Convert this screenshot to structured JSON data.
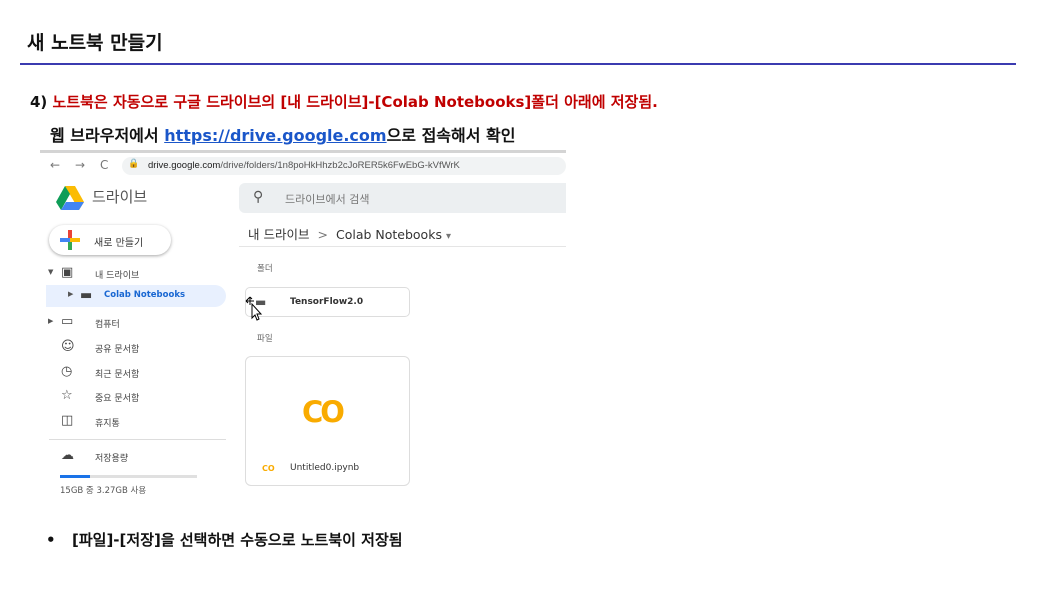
{
  "slide": {
    "title": "새 노트북 만들기",
    "step_num": "4)",
    "step_text": "노트북은 자동으로 구글 드라이브의 [내 드라이브]-[Colab Notebooks]폴더 아래에 저장됨.",
    "check_prefix": "웹 브라우저에서 ",
    "check_link": "https://drive.google.com",
    "check_suffix": "으로 접속해서 확인",
    "bullet_text": "[파일]-[저장]을 선택하면 수동으로 노트북이 저장됨"
  },
  "browser": {
    "back": "←",
    "forward": "→",
    "reload": "C",
    "lock": "🔒",
    "url_host": "drive.google.com",
    "url_path": "/drive/folders/1n8poHkHhzb2cJoRER5k6FwEbG-kVfWrK"
  },
  "drive": {
    "app_name": "드라이브",
    "search_placeholder": "드라이브에서 검색",
    "new_button": "새로 만들기",
    "sidebar": [
      {
        "label": "내 드라이브",
        "icon": "drive-icon"
      },
      {
        "label": "Colab Notebooks",
        "icon": "folder-icon"
      },
      {
        "label": "컴퓨터",
        "icon": "computer-icon"
      },
      {
        "label": "공유 문서함",
        "icon": "people-icon"
      },
      {
        "label": "최근 문서함",
        "icon": "clock-icon"
      },
      {
        "label": "중요 문서함",
        "icon": "star-icon"
      },
      {
        "label": "휴지통",
        "icon": "trash-icon"
      },
      {
        "label": "저장용량",
        "icon": "cloud-icon"
      }
    ],
    "storage_text": "15GB 중 3.27GB 사용",
    "storage_fraction": 0.218,
    "breadcrumb": {
      "root": "내 드라이브",
      "sep": ">",
      "current": "Colab Notebooks",
      "dropdown": "▾"
    },
    "folders_label": "폴더",
    "folder_name": "TensorFlow2.0",
    "files_label": "파일",
    "file_preview": "CO",
    "file_icon": "CO",
    "file_name": "Untitled0.ipynb"
  },
  "colors": {
    "accent_red": "#c00000",
    "link_blue": "#1a56c9",
    "title_rule": "#3b3bb0",
    "colab_yellow": "#f9ab00",
    "drive_active": "#1967d2"
  }
}
